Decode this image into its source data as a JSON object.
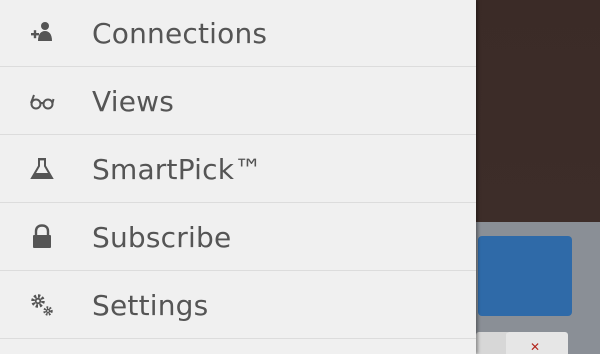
{
  "drawer": {
    "items": [
      {
        "label": "Connections",
        "icon": "add-person-icon"
      },
      {
        "label": "Views",
        "icon": "glasses-icon"
      },
      {
        "label": "SmartPick™",
        "icon": "flask-icon"
      },
      {
        "label": "Subscribe",
        "icon": "lock-icon"
      },
      {
        "label": "Settings",
        "icon": "gears-icon"
      }
    ]
  },
  "colors": {
    "drawer_background": "#f0f0f0",
    "text": "#555555",
    "divider": "#dcdcdc",
    "app_background": "#3a2a26",
    "app_card": "#2f6aa8"
  }
}
